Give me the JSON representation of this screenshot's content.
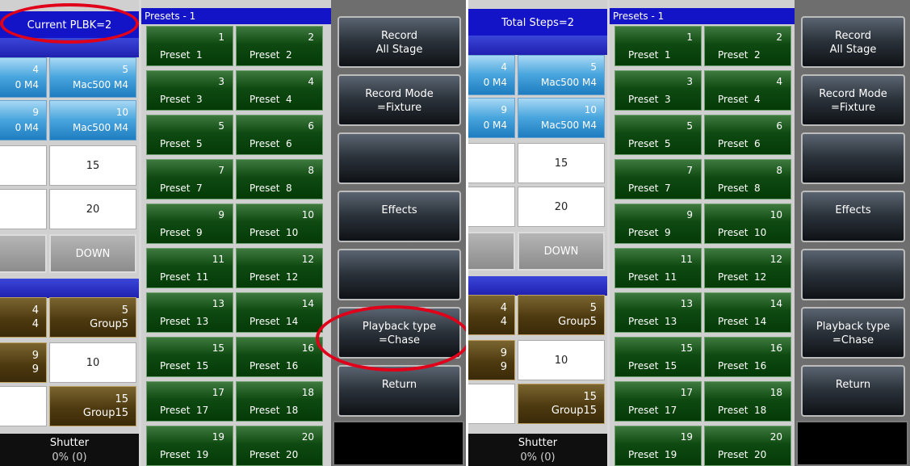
{
  "left_panel": {
    "header": "Current PLBK=2",
    "presets_header": "Presets - 1",
    "fixtures": [
      {
        "num": "4",
        "label": "0 M4"
      },
      {
        "num": "5",
        "label": "Mac500 M4"
      },
      {
        "num": "9",
        "label": "0 M4"
      },
      {
        "num": "10",
        "label": "Mac500 M4"
      }
    ],
    "cells": [
      "15",
      "20"
    ],
    "down_label": "DOWN",
    "groups": [
      {
        "num": "4",
        "label": "4"
      },
      {
        "num": "5",
        "label": "Group5"
      },
      {
        "num": "9",
        "label": "9"
      },
      {
        "num": "15",
        "label": "Group15"
      }
    ],
    "group_cell": "10",
    "shutter_label": "Shutter",
    "shutter_value": "0% (0)",
    "function_buttons": [
      "Record\nAll Stage",
      "Record Mode\n=Fixture",
      "",
      "Effects",
      "",
      "Playback type\n=Chase",
      "Return"
    ]
  },
  "right_panel": {
    "header": "Total Steps=2",
    "presets_header": "Presets - 1",
    "fixtures": [
      {
        "num": "4",
        "label": "0 M4"
      },
      {
        "num": "5",
        "label": "Mac500 M4"
      },
      {
        "num": "9",
        "label": "0 M4"
      },
      {
        "num": "10",
        "label": "Mac500 M4"
      }
    ],
    "cells": [
      "15",
      "20"
    ],
    "down_label": "DOWN",
    "groups": [
      {
        "num": "4",
        "label": "4"
      },
      {
        "num": "5",
        "label": "Group5"
      },
      {
        "num": "9",
        "label": "9"
      },
      {
        "num": "15",
        "label": "Group15"
      }
    ],
    "group_cell": "10",
    "shutter_label": "Shutter",
    "shutter_value": "0% (0)",
    "function_buttons": [
      "Record\nAll Stage",
      "Record Mode\n=Fixture",
      "",
      "Effects",
      "",
      "Playback type\n=Chase",
      "Return"
    ]
  },
  "presets": [
    {
      "num": "1",
      "label": "Preset  1"
    },
    {
      "num": "2",
      "label": "Preset  2"
    },
    {
      "num": "3",
      "label": "Preset  3"
    },
    {
      "num": "4",
      "label": "Preset  4"
    },
    {
      "num": "5",
      "label": "Preset  5"
    },
    {
      "num": "6",
      "label": "Preset  6"
    },
    {
      "num": "7",
      "label": "Preset  7"
    },
    {
      "num": "8",
      "label": "Preset  8"
    },
    {
      "num": "9",
      "label": "Preset  9"
    },
    {
      "num": "10",
      "label": "Preset  10"
    },
    {
      "num": "11",
      "label": "Preset  11"
    },
    {
      "num": "12",
      "label": "Preset  12"
    },
    {
      "num": "13",
      "label": "Preset  13"
    },
    {
      "num": "14",
      "label": "Preset  14"
    },
    {
      "num": "15",
      "label": "Preset  15"
    },
    {
      "num": "16",
      "label": "Preset  16"
    },
    {
      "num": "17",
      "label": "Preset  17"
    },
    {
      "num": "18",
      "label": "Preset  18"
    },
    {
      "num": "19",
      "label": "Preset  19"
    },
    {
      "num": "20",
      "label": "Preset  20"
    }
  ],
  "colors": {
    "header_blue": "#1313c8",
    "preset_green": "#0f4a12",
    "fixture_blue": "#4aa6de",
    "group_brown": "#4e3a10",
    "highlight_red": "#e0001a"
  }
}
